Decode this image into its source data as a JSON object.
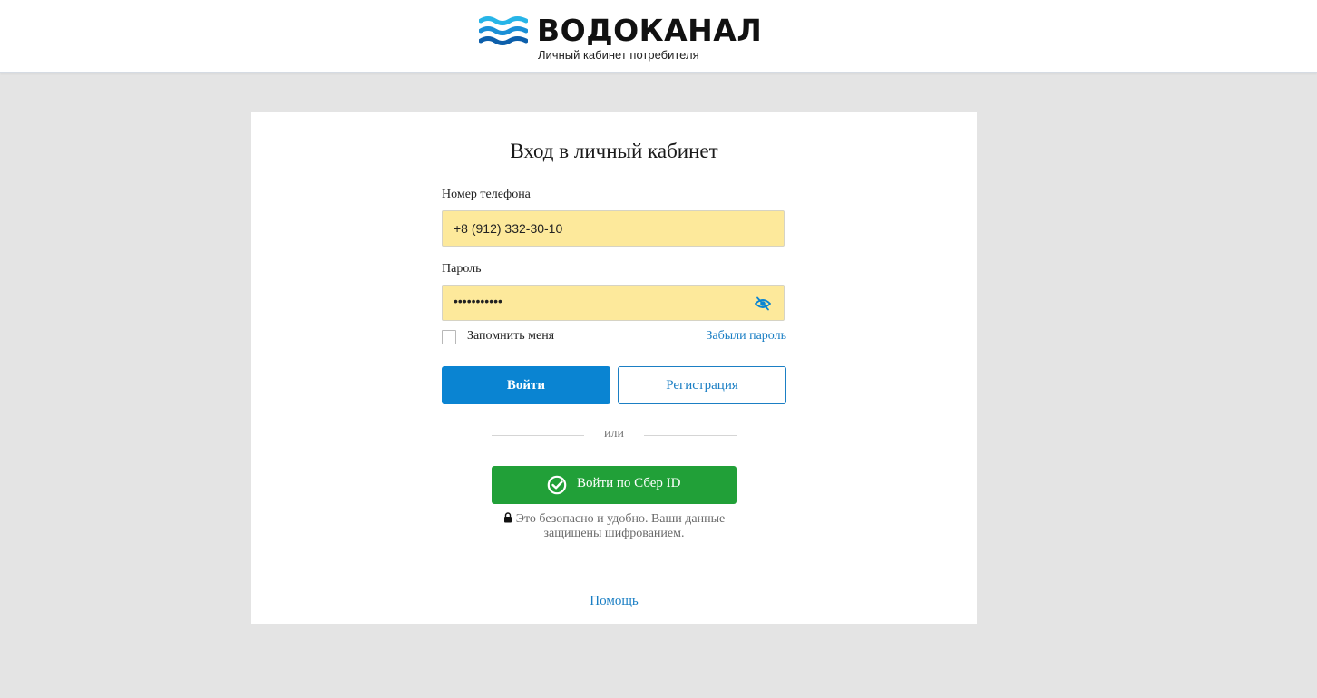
{
  "header": {
    "brand_name": "ВОДОКАНАЛ",
    "brand_subtitle": "Личный кабинет потребителя",
    "logo_icon": "waves-logo-icon"
  },
  "login": {
    "title": "Вход в личный кабинет",
    "phone_label": "Номер телефона",
    "phone_value": "+8 (912) 332-30-10",
    "password_label": "Пароль",
    "password_value": "•••••••••••",
    "password_toggle_icon": "eye-slash-icon",
    "remember_label": "Запомнить меня",
    "remember_checked": false,
    "forgot_label": "Забыли пароль",
    "login_button": "Войти",
    "register_button": "Регистрация",
    "or_text": "или",
    "sber_button": "Войти по Сбер ID",
    "sber_icon": "sber-check-icon",
    "secure_line1": "Это безопасно и удобно. Ваши данные",
    "secure_line2": "защищены шифрованием.",
    "lock_icon": "lock-icon",
    "help_link": "Помощь"
  },
  "colors": {
    "page_bg": "#e4e4e4",
    "input_autofill_bg": "#fde99b",
    "primary_blue": "#0a84d2",
    "link_blue": "#1b7fc4",
    "sber_green": "#21a038"
  }
}
